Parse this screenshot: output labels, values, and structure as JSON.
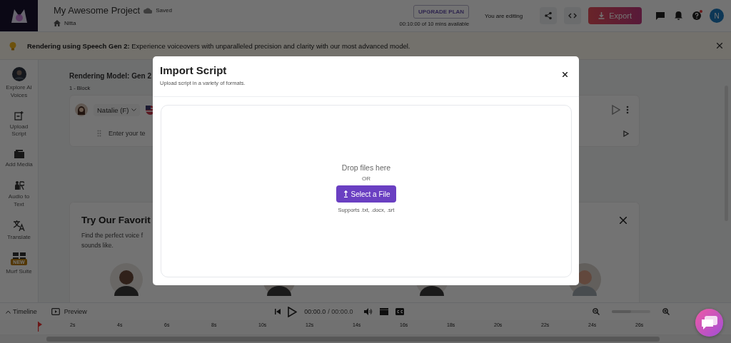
{
  "app": {
    "title": "My Awesome Project",
    "save_status": "Saved",
    "breadcrumb": "Nitta",
    "upgrade": "UPGRADE PLAN",
    "usage": "00:10:00 of 10 mins available",
    "editing": "You are editing",
    "export": "Export",
    "user_initial": "N",
    "help_notification": true
  },
  "banner": {
    "text": "**Rendering using Speech Gen 2:** Experience voiceovers with unparalleled precision and clarity with our most advanced model."
  },
  "sidebar": {
    "items": [
      {
        "kind": "avatar",
        "label": "Explore AI Voices"
      },
      {
        "kind": "upload",
        "label": "Upload Script"
      },
      {
        "kind": "media",
        "label": "Add Media"
      },
      {
        "kind": "audio",
        "label": "Audio to Text"
      },
      {
        "kind": "translate",
        "label": "Translate"
      },
      {
        "kind": "suite",
        "label": "Murf Suite",
        "badge": "NEW"
      }
    ]
  },
  "editor": {
    "model": "Rendering Model: Gen 2",
    "block_label": "1 - Block",
    "voice": "Natalie (F)",
    "placeholder": "Enter your te"
  },
  "promo": {
    "title": "Try Our Favorit",
    "line_1": "Find the perfect voice f",
    "line_2": "sounds like."
  },
  "timeline": {
    "label": "Timeline",
    "preview": "Preview",
    "time": "00:00.0",
    "duration": "/ 00:00.0",
    "zoom": {
      "level": 0.5
    },
    "ticks": [
      "2s",
      "4s",
      "6s",
      "8s",
      "10s",
      "12s",
      "14s",
      "16s",
      "18s",
      "20s",
      "22s",
      "24s",
      "26s"
    ]
  },
  "modal": {
    "title": "Import Script",
    "subtitle": "Upload script in a variety of formats.",
    "drop_text": "Drop files here",
    "or": "OR",
    "button": "Select a File",
    "supports": "Supports .txt, .docx, .srt"
  }
}
